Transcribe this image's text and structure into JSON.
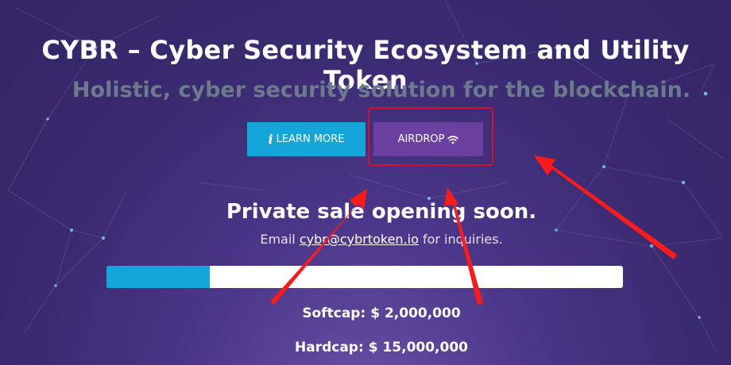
{
  "hero": {
    "title": "CYBR – Cyber Security Ecosystem and Utility Token",
    "subtitle": "Holistic, cyber security solution for the blockchain."
  },
  "buttons": {
    "learn_more": {
      "icon": "info-icon",
      "label": "LEARN MORE"
    },
    "airdrop": {
      "label": "AIRDROP",
      "icon": "wifi-icon"
    }
  },
  "sale": {
    "heading": "Private sale opening soon.",
    "email_prefix": "Email ",
    "email": "cybr@cybrtoken.io",
    "email_suffix": " for inquiries."
  },
  "progress": {
    "fraction": 0.2
  },
  "caps": {
    "softcap_label": "Softcap:",
    "softcap_value": "$ 2,000,000",
    "hardcap_label": "Hardcap:",
    "hardcap_value": "$ 15,000,000"
  },
  "colors": {
    "accent_blue": "#15a6d9",
    "airdrop_purple": "#6a3fa0",
    "highlight_red": "#d9102a",
    "background": "#3a2a70"
  }
}
